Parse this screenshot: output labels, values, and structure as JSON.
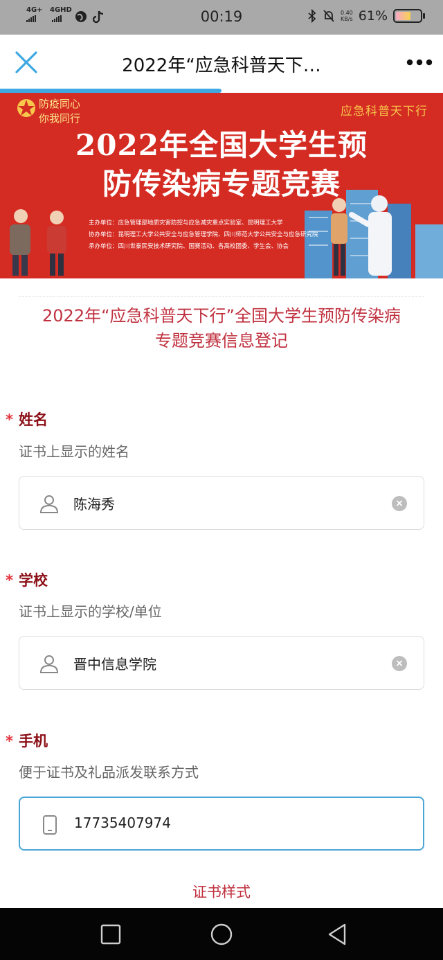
{
  "status_bar": {
    "network1": "4G+",
    "network2": "4GHD",
    "time": "00:19",
    "speed_value": "0.40",
    "speed_unit": "KB/s",
    "battery_percent": "61%",
    "battery_level": 0.61
  },
  "nav": {
    "title": "2022年“应急科普天下…",
    "close_icon": "close-icon",
    "more_icon": "more-icon",
    "load_progress": 0.5,
    "accent": "#3da8e2"
  },
  "banner": {
    "slogan_line1": "防疫同心",
    "slogan_line2": "你我同行",
    "tagline": "应急科普天下行",
    "headline_line1": "2022年全国大学生预",
    "headline_line2": "防传染病专题竞赛",
    "org_line1": "主办单位：应急管理部地质灾害防控与应急减灾重点实验室、昆明理工大学",
    "org_line2": "协办单位：昆明理工大学公共安全与应急管理学院、四川师范大学公共安全与应急研究院",
    "org_line3": "承办单位：四川世泰民安技术研究院、国赛活动、各高校团委、学生会、协会",
    "background": "#d42b23"
  },
  "form": {
    "title_line1": "2022年“应急科普天下行”全国大学生预防传染病",
    "title_line2": "专题竞赛信息登记",
    "required_mark": "*",
    "fields": [
      {
        "label": "姓名",
        "hint": "证书上显示的姓名",
        "value": "陈海秀",
        "icon": "user-icon",
        "clear": "×"
      },
      {
        "label": "学校",
        "hint": "证书上显示的学校/单位",
        "value": "晋中信息学院",
        "icon": "user-icon",
        "clear": "×"
      },
      {
        "label": "手机",
        "hint": "便于证书及礼品派发联系方式",
        "value": "17735407974",
        "icon": "phone-icon"
      }
    ],
    "certificate_link": "证书样式"
  },
  "system_nav": {
    "recent_icon": "square-icon",
    "home_icon": "circle-icon",
    "back_icon": "triangle-back-icon"
  }
}
